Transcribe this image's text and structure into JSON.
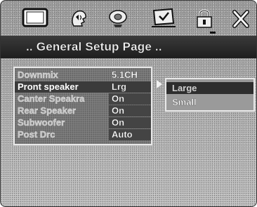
{
  "header": {
    "icons": [
      "tv-icon",
      "audio-icon",
      "speaker-icon",
      "setup-icon",
      "lock-icon",
      "close-icon"
    ],
    "title": ".. General Setup Page .."
  },
  "settings": {
    "rows": [
      {
        "label": "Downmix",
        "value": "5.1CH"
      },
      {
        "label": "Pront speaker",
        "value": "Lrg"
      },
      {
        "label": "Canter Speakra",
        "value": "On"
      },
      {
        "label": "Rear Speaker",
        "value": "On"
      },
      {
        "label": "Subwoofer",
        "value": "On"
      },
      {
        "label": "Post Drc",
        "value": "Auto"
      }
    ]
  },
  "submenu": {
    "options": [
      "Large",
      "Small"
    ]
  },
  "colors": {
    "background": "#a9a9a9",
    "title_bar": "#2a2a2a",
    "selected_row": "#3b3b3b"
  }
}
